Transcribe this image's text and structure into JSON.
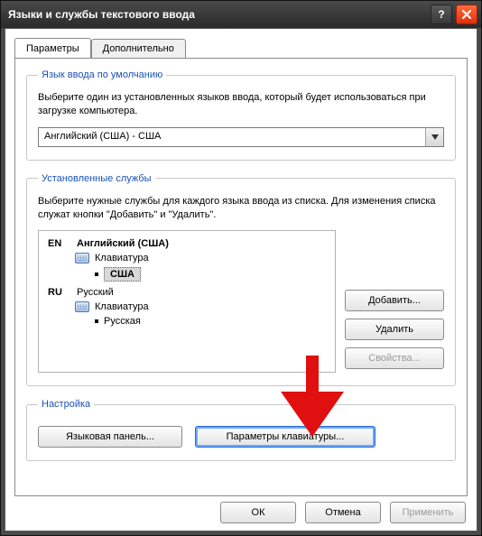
{
  "titlebar": {
    "title": "Языки и службы текстового ввода"
  },
  "tabs": {
    "parameters": "Параметры",
    "advanced": "Дополнительно"
  },
  "group_default": {
    "legend": "Язык ввода по умолчанию",
    "text": "Выберите один из установленных языков ввода, который будет использоваться при загрузке компьютера.",
    "combo_value": "Английский (США) - США"
  },
  "group_installed": {
    "legend": "Установленные службы",
    "text": "Выберите нужные службы для каждого языка ввода из списка. Для изменения списка служат кнопки \"Добавить\" и \"Удалить\".",
    "languages": {
      "en": {
        "code": "EN",
        "name": "Английский (США)",
        "sub": "Клавиатура",
        "layout": "США"
      },
      "ru": {
        "code": "RU",
        "name": "Русский",
        "sub": "Клавиатура",
        "layout": "Русская"
      }
    },
    "buttons": {
      "add": "Добавить...",
      "remove": "Удалить",
      "properties": "Свойства..."
    }
  },
  "group_settings": {
    "legend": "Настройка",
    "lang_panel": "Языковая панель...",
    "keyboard_params": "Параметры клавиатуры..."
  },
  "dialog_buttons": {
    "ok": "ОК",
    "cancel": "Отмена",
    "apply": "Применить"
  }
}
